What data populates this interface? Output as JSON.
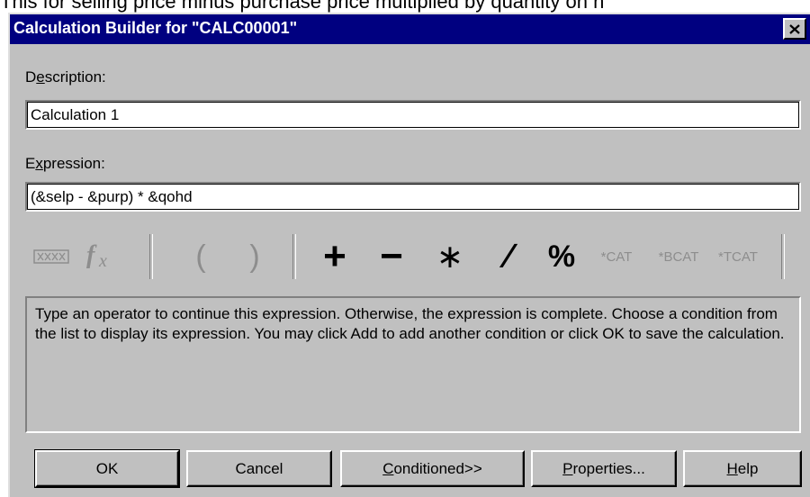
{
  "background_text": "This for selling price minus purchase price multiplied by quantity on h",
  "dialog": {
    "title": "Calculation Builder for \"CALC00001\"",
    "close_label": "×"
  },
  "description": {
    "label_pre": "D",
    "label_mnemonic": "e",
    "label_post": "scription:",
    "value": "Calculation 1"
  },
  "expression": {
    "label_pre": "E",
    "label_mnemonic": "x",
    "label_post": "pression:",
    "value": "(&selp - &purp) * &qohd"
  },
  "toolbar": {
    "field_icon": "field-icon",
    "function_icon": "function-icon",
    "open_paren": "(",
    "close_paren": ")",
    "plus": "+",
    "minus": "−",
    "multiply": "∗",
    "divide": "∕",
    "percent": "%",
    "cat": "*CAT",
    "bcat": "*BCAT",
    "tcat": "*TCAT"
  },
  "info_text": "Type an operator to continue this expression.  Otherwise, the expression is complete. Choose a condition from the list to display its expression.  You may click Add to add another condition or click OK to save the calculation.",
  "buttons": {
    "ok": "OK",
    "cancel": "Cancel",
    "conditioned_mnemonic": "C",
    "conditioned_rest": "onditioned>>",
    "properties_mnemonic": "P",
    "properties_rest": "roperties...",
    "help_mnemonic": "H",
    "help_rest": "elp"
  },
  "colors": {
    "titlebar": "#000080",
    "face": "#c0c0c0",
    "disabled": "#8d8d8d"
  }
}
